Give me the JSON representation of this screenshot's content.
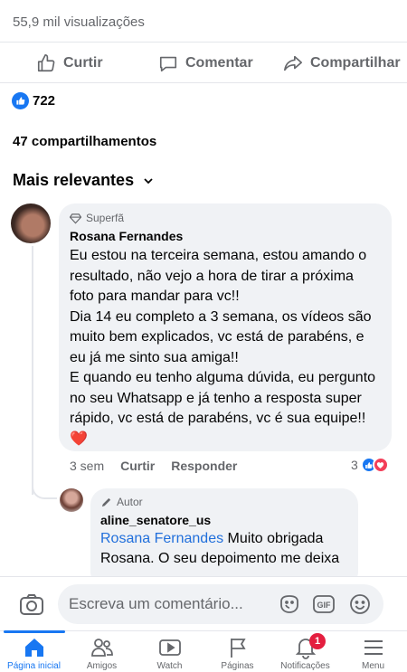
{
  "post": {
    "views": "55,9 mil visualizações",
    "reaction_count": "722",
    "shares": "47 compartilhamentos"
  },
  "actions": {
    "like": "Curtir",
    "comment": "Comentar",
    "share": "Compartilhar"
  },
  "comments_sort": "Mais relevantes",
  "comments": [
    {
      "badge": "Superfã",
      "author": "Rosana Fernandes",
      "text": "Eu estou na terceira semana, estou amando o resultado, não vejo a hora de tirar a próxima foto para mandar para vc!!\nDia 14 eu completo a 3 semana, os vídeos são muito bem explicados, vc está de parabéns,  e eu já me sinto sua amiga!!\nE quando eu tenho alguma dúvida, eu pergunto no seu Whatsapp e já tenho a resposta super rápido, vc está de parabéns, vc é sua equipe!! ❤️",
      "time": "3 sem",
      "like_label": "Curtir",
      "reply_label": "Responder",
      "reactions": "3"
    }
  ],
  "reply": {
    "badge": "Autor",
    "author": "aline_senatore_us",
    "mention": "Rosana Fernandes",
    "text": " Muito obrigada Rosana. O seu depoimento me deixa"
  },
  "composer": {
    "placeholder": "Escreva um comentário..."
  },
  "tabbar": {
    "items": [
      {
        "label": "Página inicial",
        "icon": "home-icon"
      },
      {
        "label": "Amigos",
        "icon": "friends-icon"
      },
      {
        "label": "Watch",
        "icon": "watch-icon"
      },
      {
        "label": "Páginas",
        "icon": "flag-icon"
      },
      {
        "label": "Notificações",
        "icon": "bell-icon"
      },
      {
        "label": "Menu",
        "icon": "menu-icon"
      }
    ],
    "notification_count": "1"
  },
  "colors": {
    "accent": "#1877f2",
    "love": "#f33e58",
    "secondary_text": "#65676b",
    "bubble": "#f0f2f5"
  }
}
